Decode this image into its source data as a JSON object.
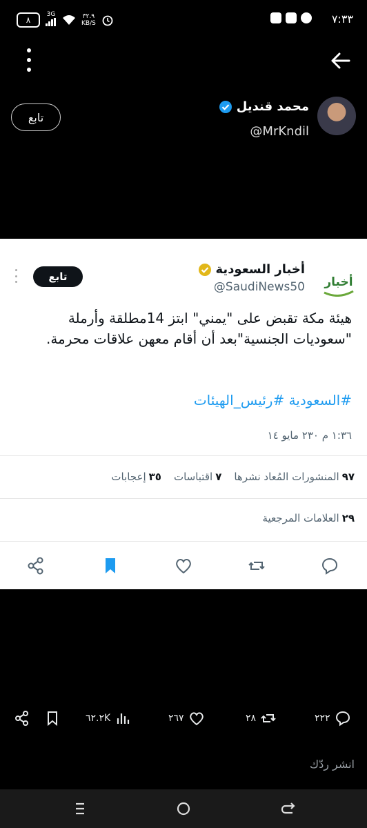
{
  "status_bar": {
    "time": "٧:٣٣",
    "battery": "٨",
    "network_type": "3G",
    "speed_value": "٣٢.٩",
    "speed_unit": "KB/S"
  },
  "icons": {
    "back": "back-arrow-icon",
    "menu": "more-vertical-icon",
    "verified": "verified-badge-icon"
  },
  "header": {
    "name": "محمد قنديل",
    "handle": "@MrKndil",
    "follow_label": "تابع"
  },
  "quoted_post": {
    "name": "أخبار السعودية",
    "handle": "@SaudiNews50",
    "logo_text": "أخبار",
    "follow_label": "تابع",
    "body_line1": "هيئة مكة تقبض على \"يمني\" ابتز 14مطلقة وأرملة",
    "body_line2": "\"سعوديات الجنسية\"بعد أن أقام معهن علاقات محرمة.",
    "hashtags": "#السعودية #رئيس_الهيئات",
    "timestamp": "١:٣٦ م ٢٣٠ مايو ١٤",
    "reposts_count": "٩٧",
    "reposts_label": "المنشورات المُعاد نشرها",
    "quotes_count": "٧",
    "quotes_label": "اقتباسات",
    "likes_count": "٣٥",
    "likes_label": "إعجابات",
    "bookmarks_count": "٢٩",
    "bookmarks_label": "العلامات المرجعية"
  },
  "bottom_actions": {
    "replies": "٢٢٢",
    "reposts": "٢٨",
    "likes": "٢٦٧",
    "views": "٦٢.٢K"
  },
  "reply": {
    "placeholder": "انشر ردّك"
  },
  "colors": {
    "accent": "#1d9bf0",
    "verified_gold": "#e2b719",
    "background": "#000000"
  }
}
